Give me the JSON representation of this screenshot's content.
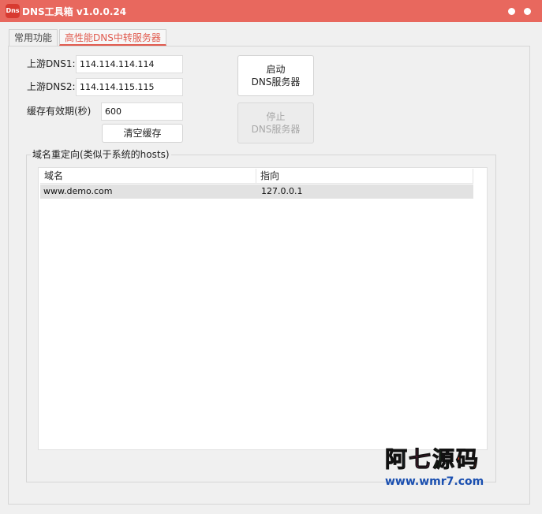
{
  "window": {
    "icon_text": "Dns",
    "title": "DNS工具箱 v1.0.0.24"
  },
  "tabs": [
    {
      "label": "常用功能",
      "active": false
    },
    {
      "label": "高性能DNS中转服务器",
      "active": true
    }
  ],
  "settings": {
    "upstream1_label": "上游DNS1:",
    "upstream1_value": "114.114.114.114",
    "upstream2_label": "上游DNS2:",
    "upstream2_value": "114.114.115.115",
    "cache_ttl_label": "缓存有效期(秒)",
    "cache_ttl_value": "600",
    "clear_cache_label": "清空缓存"
  },
  "server_buttons": {
    "start_line1": "启动",
    "start_line2": "DNS服务器",
    "stop_line1": "停止",
    "stop_line2": "DNS服务器",
    "stop_disabled": true
  },
  "redirect": {
    "legend": "域名重定向(类似于系统的hosts)",
    "columns": [
      "域名",
      "指向"
    ],
    "rows": [
      {
        "domain": "www.demo.com",
        "target": "127.0.0.1"
      }
    ]
  },
  "watermark": {
    "title_chars": [
      "阿",
      "七",
      "源",
      "码"
    ],
    "url": "www.wmr7.com"
  },
  "colors": {
    "titlebar": "#e8685e",
    "accent": "#e05a4e",
    "watermark_chars": [
      "#1c8fd6",
      "#d6257a",
      "#2a9a3c",
      "#d64020"
    ]
  }
}
